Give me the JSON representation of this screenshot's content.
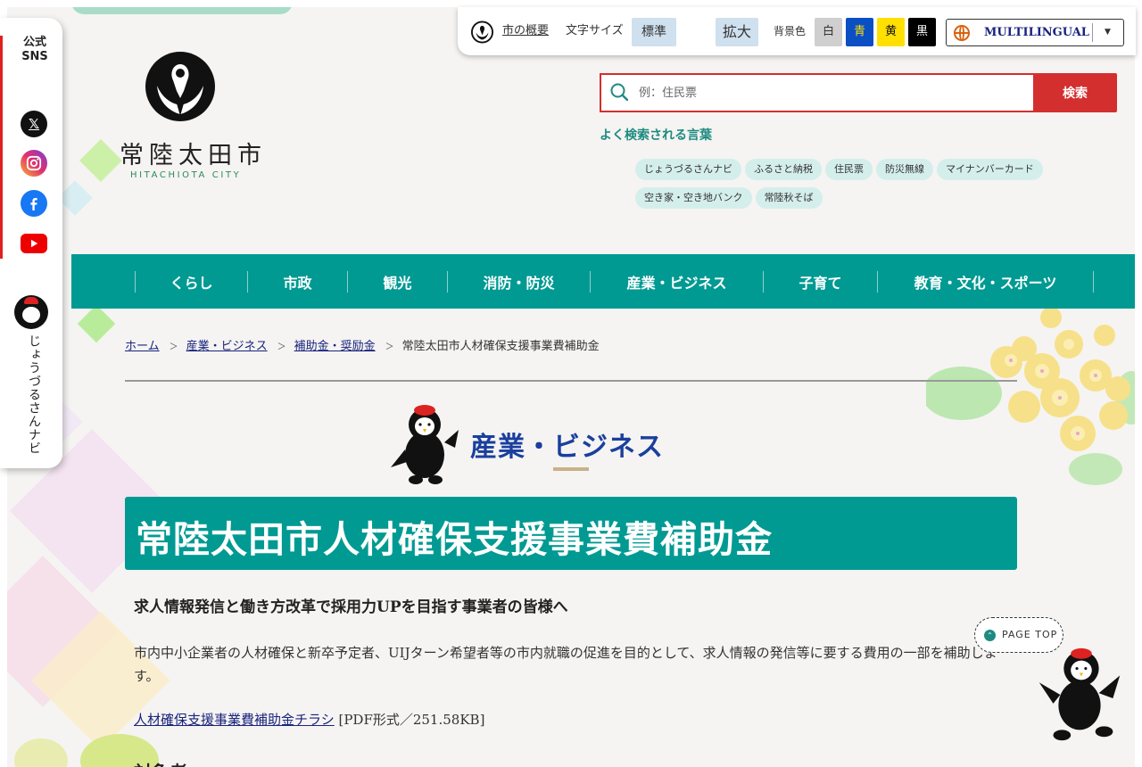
{
  "site": {
    "logo_text": "常陸太田市",
    "logo_sub": "HITACHIOTA CITY"
  },
  "sns": {
    "title_line1": "公式",
    "title_line2": "SNS",
    "x_glyph": "𝕏",
    "navi_label": "じょうづるさんナビ"
  },
  "utility": {
    "overview_link": "市の概要",
    "font_size_label": "文字サイズ",
    "font_standard": "標準",
    "font_large": "拡大",
    "bg_label": "背景色",
    "bg_white": "白",
    "bg_blue": "青",
    "bg_yellow": "黄",
    "bg_black": "黒",
    "multilingual": "MULTILINGUAL",
    "caret": "▼"
  },
  "search": {
    "placeholder": "例：住民票",
    "button": "検索",
    "popular_title": "よく検索される言葉",
    "keywords": [
      "じょうづるさんナビ",
      "ふるさと納税",
      "住民票",
      "防災無線",
      "マイナンバーカード",
      "空き家・空き地バンク",
      "常陸秋そば"
    ]
  },
  "nav": {
    "items": [
      "くらし",
      "市政",
      "観光",
      "消防・防災",
      "産業・ビジネス",
      "子育て",
      "教育・文化・スポーツ"
    ]
  },
  "breadcrumb": {
    "home": "ホーム",
    "level1": "産業・ビジネス",
    "level2": "補助金・奨励金",
    "current": "常陸太田市人材確保支援事業費補助金",
    "separator": "＞"
  },
  "category": {
    "title": "産業・ビジネス"
  },
  "page": {
    "title": "常陸太田市人材確保支援事業費補助金",
    "lead": "求人情報発信と働き方改革で採用力UPを目指す事業者の皆様へ",
    "body": "市内中小企業者の人材確保と新卒予定者、UIJターン希望者等の市内就職の促進を目的として、求人情報の発信等に要する費用の一部を補助します。",
    "pdf_link": "人材確保支援事業費補助金チラシ",
    "pdf_meta": " [PDF形式／251.58KB]",
    "next_heading": "対象者"
  },
  "pagetop": {
    "label": "PAGE TOP",
    "arrow": "⌃"
  },
  "colors": {
    "brand_teal": "#009a93",
    "search_red": "#d32f2f",
    "category_blue": "#1a3f9e",
    "bg_blue": "#0b4fc4",
    "bg_yellow": "#ffe000"
  }
}
